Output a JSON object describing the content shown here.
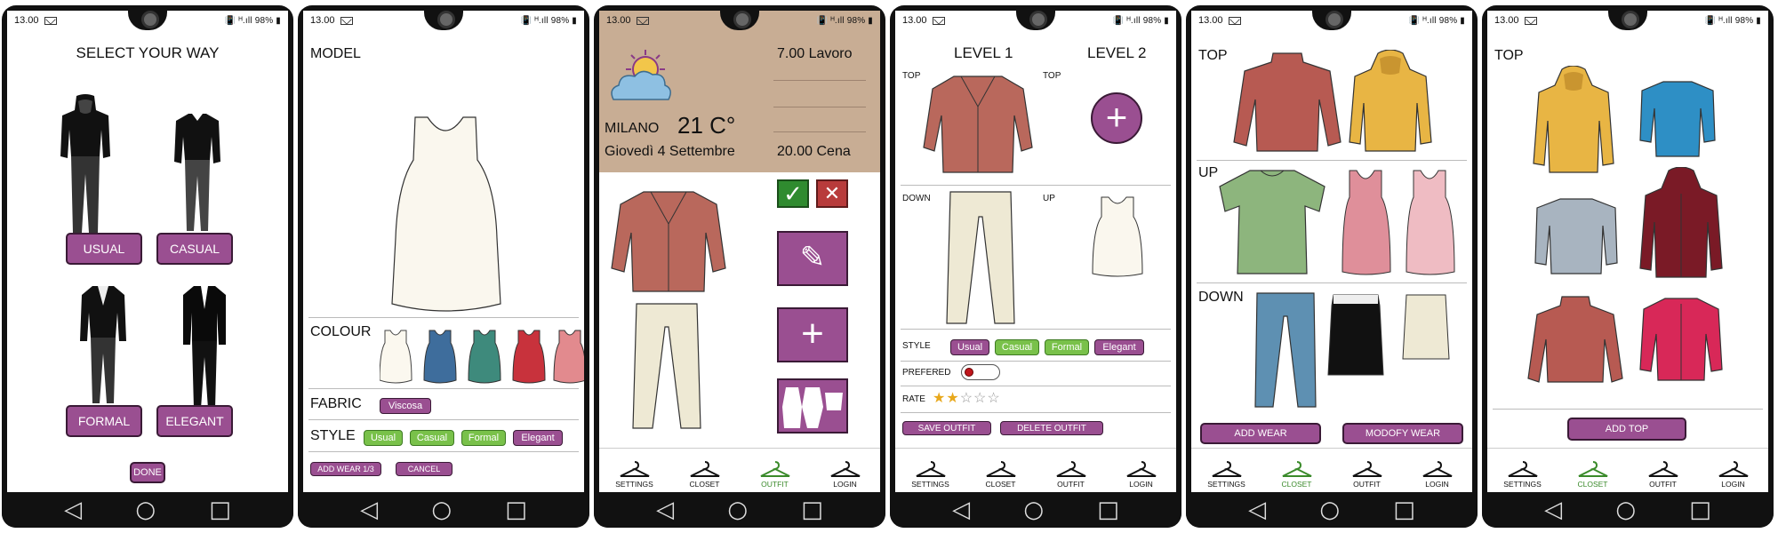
{
  "status": {
    "time": "13.00",
    "right": "📳 ᴴ.ıll 98% ▮"
  },
  "tabs": [
    "SETTINGS",
    "CLOSET",
    "OUTFIT",
    "LOGIN"
  ],
  "colors": {
    "purple": "#9a4f91",
    "green": "#79c14a",
    "beige": "#c8ad94"
  },
  "s1": {
    "title": "SELECT YOUR WAY",
    "usual": "USUAL",
    "casual": "CASUAL",
    "formal": "FORMAL",
    "elegant": "ELEGANT",
    "done": "DONE"
  },
  "s2": {
    "model": "MODEL",
    "colour": "COLOUR",
    "fabric": "FABRIC",
    "fabric_value": "Viscosa",
    "style": "STYLE",
    "styles": [
      "Usual",
      "Casual",
      "Formal",
      "Elegant"
    ],
    "add": "ADD WEAR 1/3",
    "cancel": "CANCEL"
  },
  "s3": {
    "city": "MILANO",
    "temp": "21 C°",
    "date": "Giovedì 4 Settembre",
    "event1": "7.00 Lavoro",
    "event2": "20.00 Cena"
  },
  "s4": {
    "level1": "LEVEL 1",
    "level2": "LEVEL 2",
    "top": "TOP",
    "top2": "TOP",
    "down": "DOWN",
    "up": "UP",
    "style": "STYLE",
    "styles": [
      "Usual",
      "Casual",
      "Formal",
      "Elegant"
    ],
    "prefered": "PREFERED",
    "rate": "RATE",
    "rating": 2,
    "save": "SAVE OUTFIT",
    "delete": "DELETE OUTFIT"
  },
  "s5": {
    "top": "TOP",
    "up": "UP",
    "down": "DOWN",
    "add": "ADD WEAR",
    "modify": "MODOFY WEAR"
  },
  "s6": {
    "top": "TOP",
    "add": "ADD TOP"
  }
}
